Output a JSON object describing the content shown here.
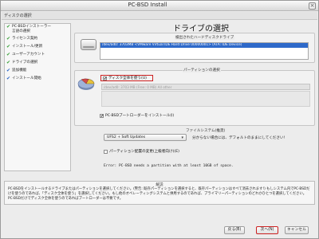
{
  "window": {
    "title": "PC-BSD Install",
    "close_glyph": "×"
  },
  "subtitle": "ディスクの選択",
  "heading": "ドライブの選択",
  "sidebar": {
    "items": [
      {
        "label": "PC-BSDインストーラー",
        "label2": "言語の選択",
        "icon": "check-green"
      },
      {
        "label": "ライセンス契約",
        "icon": "check-green"
      },
      {
        "label": "インストール/更新",
        "icon": "check-green"
      },
      {
        "label": "ユーザーアカウント",
        "icon": "check-green"
      },
      {
        "label": "ドライブの選択",
        "icon": "check-green"
      },
      {
        "label": "追加機能",
        "icon": "check-blue"
      },
      {
        "label": "インストール開始",
        "icon": "check-blue"
      }
    ]
  },
  "disks": {
    "group_label": "検出されたハードディスクドライブ",
    "selected": "/dev/ad0: 3703MB <VMware Virtual IDE Hard Drive 00000001> (ATA: IDE Device)"
  },
  "partition": {
    "group_label": "パーティションの選択",
    "use_whole_disk_label": "ディスク全体を使う(U)",
    "use_whole_disk_checked": true,
    "partition_field_text": "/dev/ad0: 3703 MB (Free: 0 MB) All other"
  },
  "bootloader": {
    "label": "PC-BSDブートローダーをインストール(I)",
    "checked": true
  },
  "filesystem": {
    "label": "ファイルシステム(推奨)",
    "selected": "UFS2 + Soft Updates",
    "hint": "分からない場合には、デフォルトのままにしてください!"
  },
  "modify_partition": {
    "label": "パーティション配置の変更(上級者向け)(E)",
    "checked": false
  },
  "error": "Error: PC-BSD needs a partition with at least 10GB of space.",
  "help": {
    "title": "解説",
    "text": "PC-BSDをインストールするドライブまたはパーティションを選択してください。(警告: 既存パーティションを選択すると、既存パーティションはすべて消去されます!) もしシステム内でPC-BSDだけを使うのであれば、「ディスク全体を使う」を選択してください。もし他のオペレーティングシステムと併用するのであれば、プライマリーパーティションのどれかひとつを選択してください。PC-BSDだけでディスク全体を使うのであればブートローダーは不要です。"
  },
  "buttons": {
    "back": "戻る(B)",
    "next": "次へ(N)",
    "cancel": "キャンセル"
  },
  "colors": {
    "selection": "#2e69c9",
    "highlight_border": "#cc2020",
    "check_green": "#3aa23a"
  }
}
